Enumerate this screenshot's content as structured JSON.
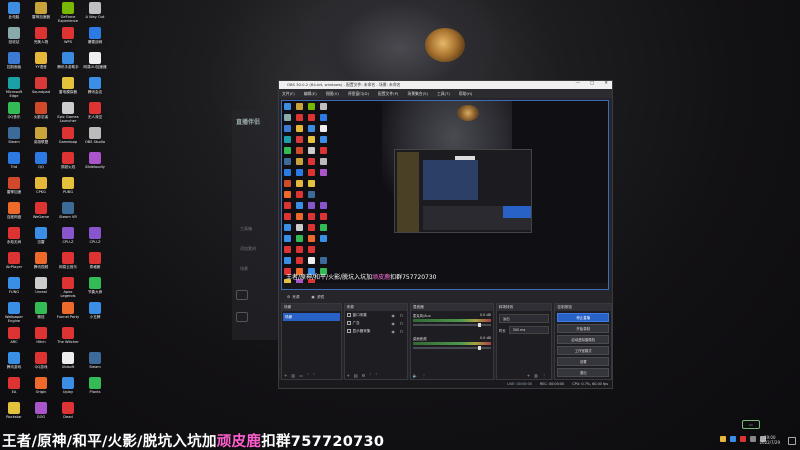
{
  "desktop_icons": [
    {
      "label": "此电脑",
      "color": "#3d8ee0"
    },
    {
      "label": "雷神加速器",
      "color": "#c9a43a"
    },
    {
      "label": "GeForce Experience",
      "color": "#76b900"
    },
    {
      "label": "A Way Out",
      "color": "#c0c0c0"
    },
    {
      "label": "回收站",
      "color": "#8aa"
    },
    {
      "label": "完美人物",
      "color": "#d33"
    },
    {
      "label": "WPS",
      "color": "#d33"
    },
    {
      "label": "暴雪战网",
      "color": "#2c7be5"
    },
    {
      "label": "控制面板",
      "color": "#3b7bd4"
    },
    {
      "label": "YY语音",
      "color": "#e5b73b"
    },
    {
      "label": "腾讯手游助手",
      "color": "#3b8be0"
    },
    {
      "label": "网易UU加速器",
      "color": "#eee"
    },
    {
      "label": "Microsoft Edge",
      "color": "#1aa1a8"
    },
    {
      "label": "Soundpad",
      "color": "#d83a3a"
    },
    {
      "label": "雷电模拟器",
      "color": "#e5c23b"
    },
    {
      "label": "腾讯会议",
      "color": "#3a8ee6"
    },
    {
      "label": "QQ音乐",
      "color": "#33bb55"
    },
    {
      "label": "火影忍者",
      "color": "#d04a2a"
    },
    {
      "label": "Epic Games Launcher",
      "color": "#ccc"
    },
    {
      "label": "无人深空",
      "color": "#d33"
    },
    {
      "label": "Steam",
      "color": "#3c6b9a"
    },
    {
      "label": "英雄联盟",
      "color": "#c9a43a"
    },
    {
      "label": "Gameloop",
      "color": "#d33"
    },
    {
      "label": "OBS Studio",
      "color": "#bbb"
    },
    {
      "label": "Trid",
      "color": "#2c7be5"
    },
    {
      "label": "QQ",
      "color": "#2c7be5"
    },
    {
      "label": "穿越火线",
      "color": "#d33"
    },
    {
      "label": "Slideloudly",
      "color": "#aa55cc"
    },
    {
      "label": "雷神加速",
      "color": "#d04a2a"
    },
    {
      "label": "CPKG",
      "color": "#e5b73b"
    },
    {
      "label": "PUBG",
      "color": "#e5c23b"
    },
    {
      "label": "",
      "color": "transparent"
    },
    {
      "label": "百度网盘",
      "color": "#ee6a2a"
    },
    {
      "label": "WeGame",
      "color": "#d33"
    },
    {
      "label": "Steam VR",
      "color": "#3c6b9a"
    },
    {
      "label": "",
      "color": "transparent"
    },
    {
      "label": "永劫无间",
      "color": "#d33"
    },
    {
      "label": "迅雷",
      "color": "#3a8ee6"
    },
    {
      "label": "CPU-Z",
      "color": "#8855cc"
    },
    {
      "label": "CPU-Z",
      "color": "#8855cc"
    },
    {
      "label": "AirPlayer",
      "color": "#d33"
    },
    {
      "label": "腾讯视频",
      "color": "#ee6a2a"
    },
    {
      "label": "网易云音乐",
      "color": "#d33"
    },
    {
      "label": "泰格朗",
      "color": "#d33"
    },
    {
      "label": "FUNG",
      "color": "#3a8ee6"
    },
    {
      "label": "Unreal",
      "color": "#ccc"
    },
    {
      "label": "Apex Legends",
      "color": "#d33"
    },
    {
      "label": "节奏大师",
      "color": "#33bb55"
    },
    {
      "label": "Wallpaper Engine",
      "color": "#3a8ee6"
    },
    {
      "label": "微信",
      "color": "#33bb55"
    },
    {
      "label": "Funnel Party",
      "color": "#ee6a2a"
    },
    {
      "label": "小丑牌",
      "color": "#3a8ee6"
    },
    {
      "label": "ARC",
      "color": "#d33"
    },
    {
      "label": "Hitch",
      "color": "#d33"
    },
    {
      "label": "The Witcher",
      "color": "#d33"
    },
    {
      "label": "",
      "color": "transparent"
    },
    {
      "label": "腾讯游戏",
      "color": "#3a8ee6"
    },
    {
      "label": "QQ游戏",
      "color": "#d33"
    },
    {
      "label": "Ubisoft",
      "color": "#eee"
    },
    {
      "label": "Steam",
      "color": "#3c6b9a"
    },
    {
      "label": "EA",
      "color": "#d33"
    },
    {
      "label": "Origin",
      "color": "#ee6a2a"
    },
    {
      "label": "Uplay",
      "color": "#3a8ee6"
    },
    {
      "label": "Plants",
      "color": "#33bb55"
    },
    {
      "label": "Rockstar",
      "color": "#e5c23b"
    },
    {
      "label": "GOG",
      "color": "#aa55cc"
    },
    {
      "label": "Dead",
      "color": "#d33"
    },
    {
      "label": "",
      "color": "transparent"
    }
  ],
  "background_app": {
    "logo": "直播伴侣",
    "lines": [
      "工具箱",
      "添加素材",
      "场景"
    ]
  },
  "obs": {
    "title": "OBS 30.0.2 (64-bit, windows) - 配置文件: 未命名 - 场景: 未命名",
    "window_controls": [
      "—",
      "□",
      "✕"
    ],
    "menu": [
      "文件(F)",
      "编辑(E)",
      "视图(V)",
      "停靠窗口(D)",
      "配置文件(P)",
      "场景集合(S)",
      "工具(T)",
      "帮助(H)"
    ],
    "preview_caption_prefix": "王者/原神/和平/火影/脱坑入坑加",
    "preview_caption_name": "顽皮鹿",
    "preview_caption_suffix": "扣群757720730",
    "tabs": [
      "来源",
      "滤镜"
    ],
    "docks": {
      "scenes": {
        "title": "场景",
        "items": [
          "场景"
        ]
      },
      "sources": {
        "title": "来源",
        "items": [
          "窗口采集",
          "广告",
          "显示器采集"
        ]
      },
      "mixer": {
        "title": "混音器",
        "channels": [
          {
            "name": "麦克风/Aux",
            "db": "0.0 dB"
          },
          {
            "name": "桌面音频",
            "db": "0.0 dB"
          }
        ]
      },
      "transitions": {
        "title": "转场特效",
        "type": "淡出",
        "duration_label": "时长",
        "duration": "300 ms"
      },
      "controls": {
        "title": "控制按钮",
        "buttons": [
          "停止直播",
          "开始录制",
          "启动虚拟摄像机",
          "工作室模式",
          "设置",
          "退出"
        ]
      }
    },
    "status": {
      "live": "LIVE: 00:00:00",
      "rec": "REC: 00:00:00",
      "cpu": "CPU: 0.7%, 60.00 fps"
    }
  },
  "overlay_caption": {
    "prefix": "王者/原神/和平/火影/脱坑入坑加",
    "name": "顽皮鹿",
    "suffix": "扣群757720730"
  },
  "taskbar": {
    "time": "19:00",
    "date": "2022/7/29"
  },
  "colors": {
    "accent": "#2862c7",
    "caption_pink": "#ff5fd0"
  }
}
